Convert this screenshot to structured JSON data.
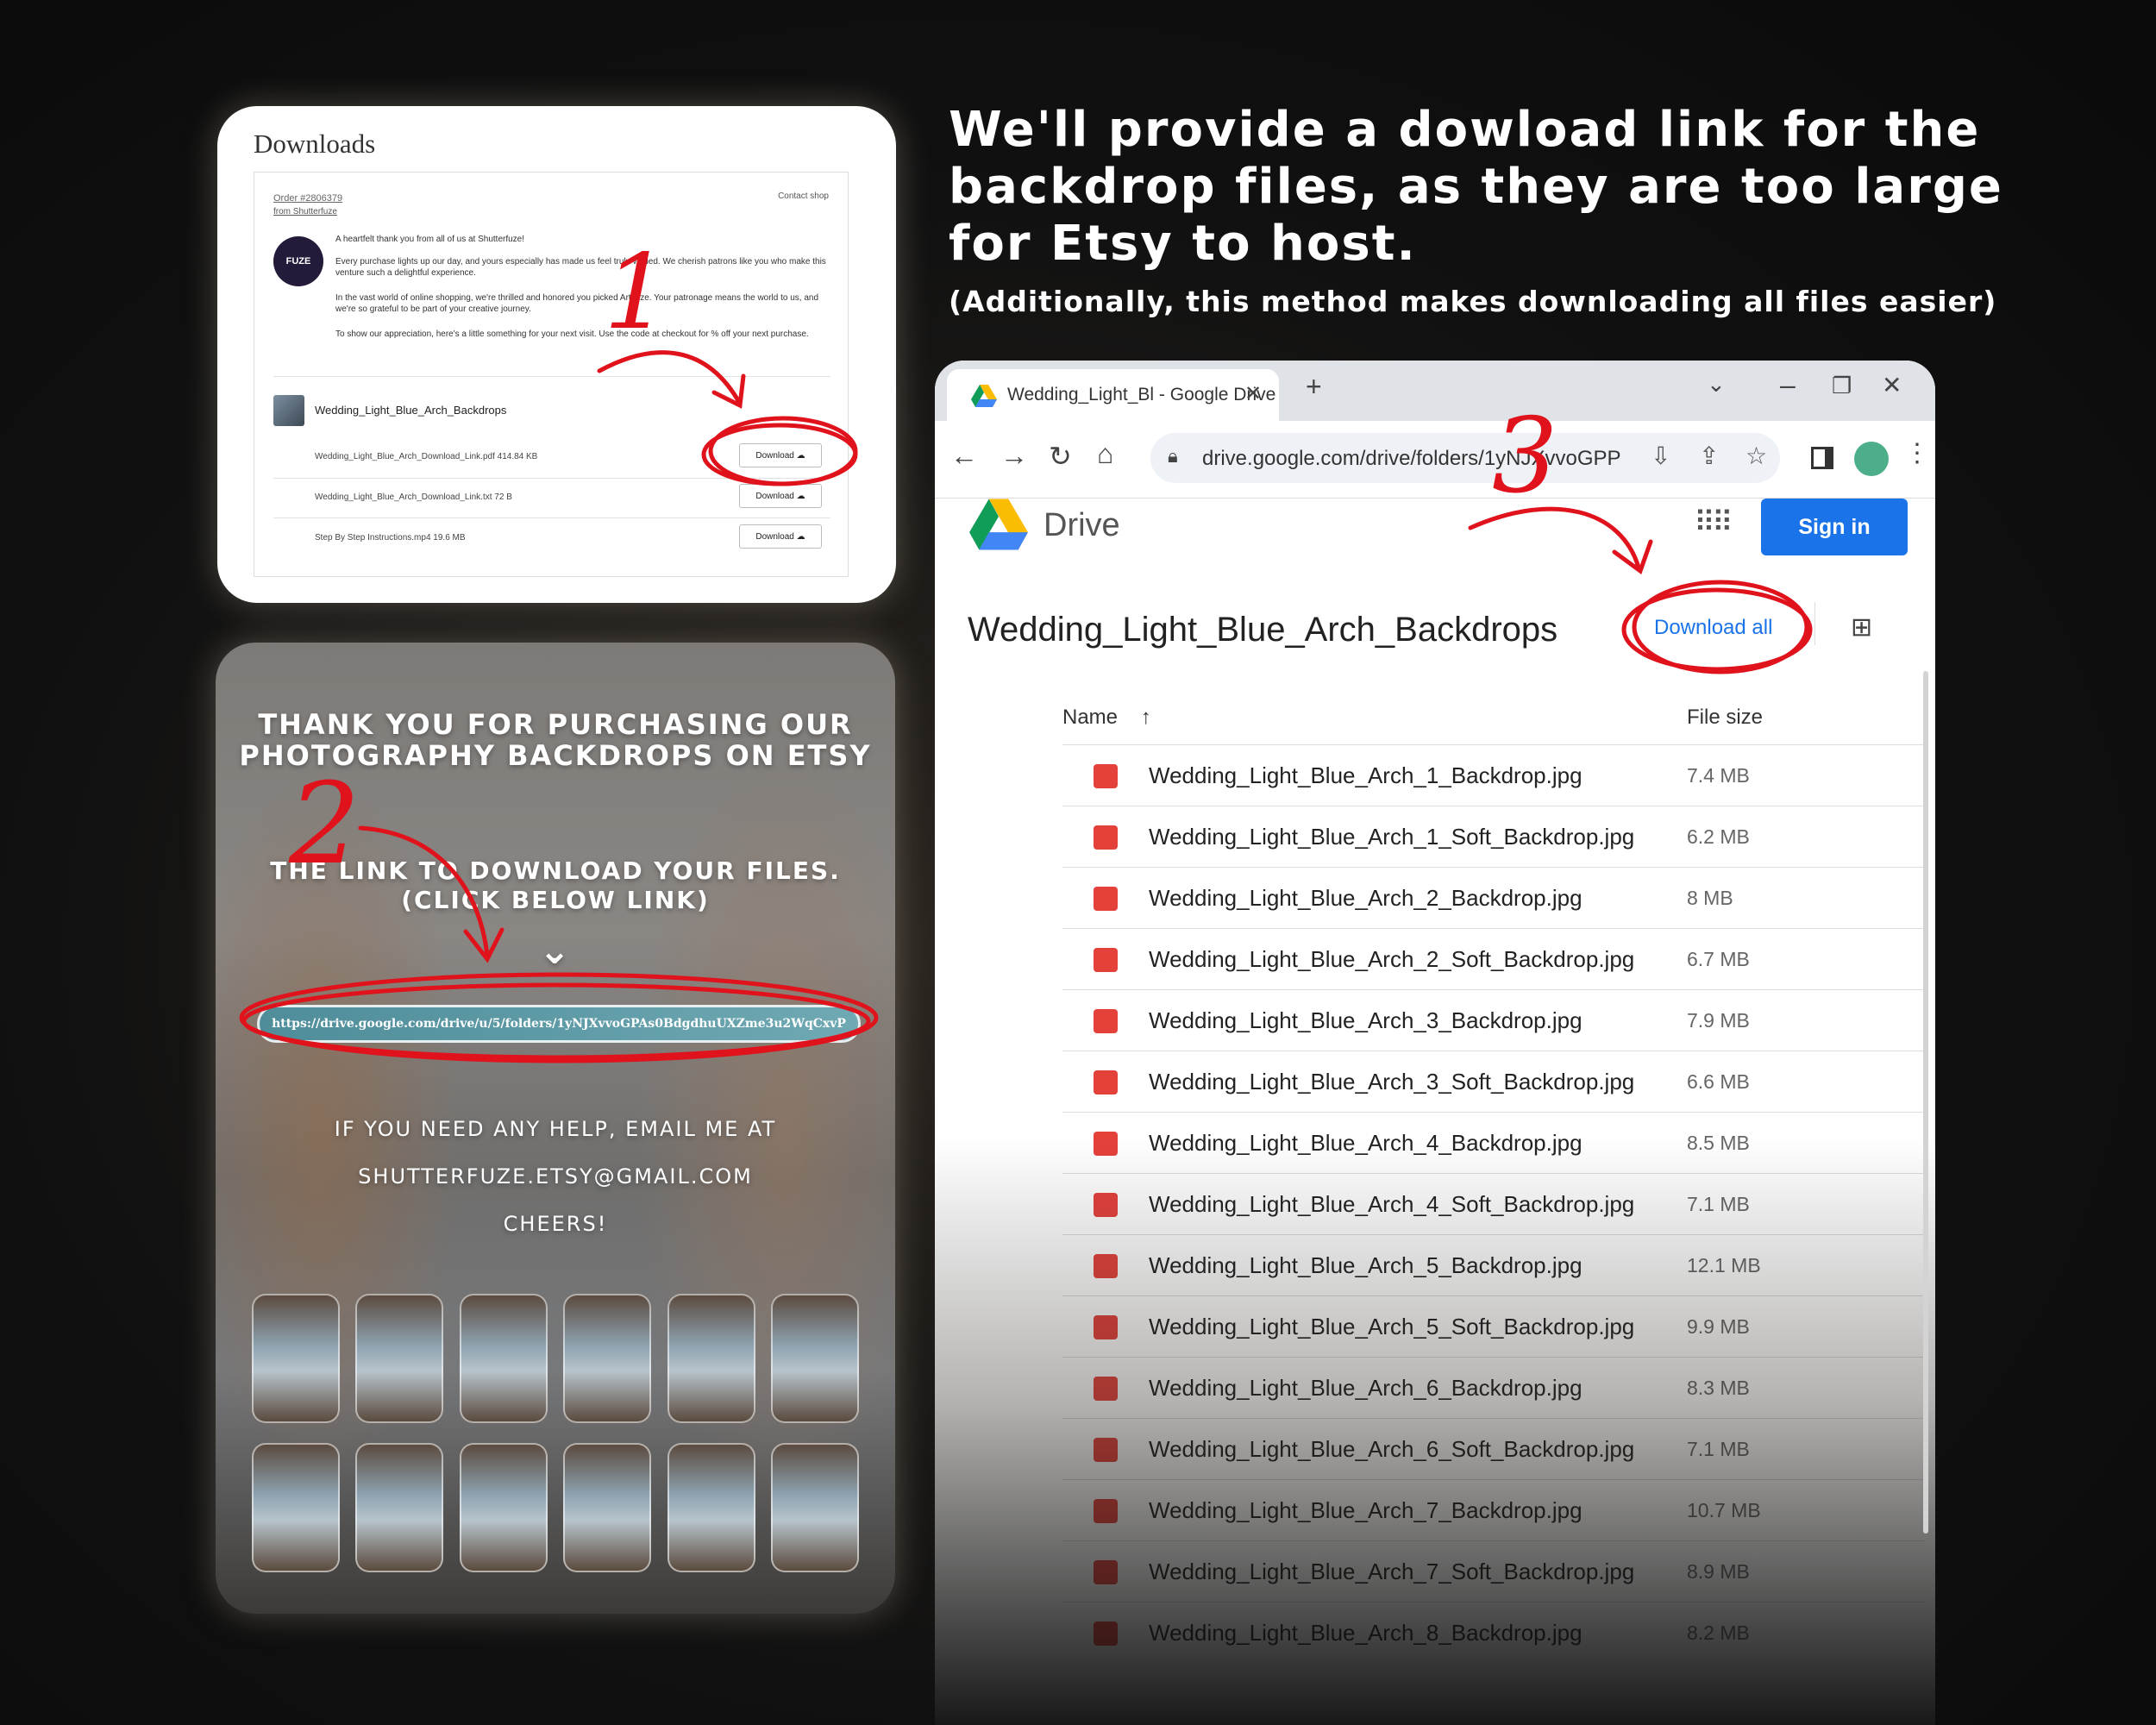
{
  "headline": "We'll provide a dowload link for the backdrop files, as they are too large for Etsy to host.",
  "subline": "(Additionally, this method makes downloading all files easier)",
  "etsy": {
    "title": "Downloads",
    "order": "Order #2806379",
    "from_shop": "from Shutterfuze",
    "contact": "Contact shop",
    "avatar": "FUZE",
    "msg1": "A heartfelt thank you from all of us at Shutterfuze!",
    "msg2": "Every purchase lights up our day, and yours especially has made us feel truly valued. We cherish patrons like you who make this venture such a delightful experience.",
    "msg3": "In the vast world of online shopping, we're thrilled and honored you picked Artifuze. Your patronage means the world to us, and we're so grateful to be part of your creative journey.",
    "msg4": "To show our appreciation, here's a little something for your next visit. Use the code at checkout for % off your next purchase.",
    "product": "Wedding_Light_Blue_Arch_Backdrops",
    "files": [
      {
        "name": "Wedding_Light_Blue_Arch_Download_Link.pdf  414.84 KB",
        "button": "Download"
      },
      {
        "name": "Wedding_Light_Blue_Arch_Download_Link.txt  72 B",
        "button": "Download"
      },
      {
        "name": "Step By Step Instructions.mp4  19.6 MB",
        "button": "Download"
      }
    ]
  },
  "thanks": {
    "line1": "THANK YOU FOR PURCHASING OUR",
    "line2": "PHOTOGRAPHY BACKDROPS ON ETSY",
    "link_title1": "THE LINK TO DOWNLOAD YOUR FILES.",
    "link_title2": "(CLICK BELOW LINK)",
    "url": "https://drive.google.com/drive/u/5/folders/1yNJXvvoGPAs0BdgdhuUXZme3u2WqCxvP",
    "help1": "IF YOU NEED ANY HELP, EMAIL ME AT",
    "help2": "SHUTTERFUZE.ETSY@GMAIL.COM",
    "help3": "CHEERS!"
  },
  "steps": [
    "1",
    "2",
    "3"
  ],
  "browser": {
    "tab_title": "Wedding_Light_Bl - Google Drive",
    "url": "drive.google.com/drive/folders/1yNJXvvoGPP",
    "app_name": "Drive",
    "sign_in": "Sign in",
    "folder": "Wedding_Light_Blue_Arch_Backdrops",
    "download_all": "Download all",
    "col_name": "Name",
    "col_size": "File size",
    "files": [
      {
        "name": "Wedding_Light_Blue_Arch_1_Backdrop.jpg",
        "size": "7.4 MB"
      },
      {
        "name": "Wedding_Light_Blue_Arch_1_Soft_Backdrop.jpg",
        "size": "6.2 MB"
      },
      {
        "name": "Wedding_Light_Blue_Arch_2_Backdrop.jpg",
        "size": "8 MB"
      },
      {
        "name": "Wedding_Light_Blue_Arch_2_Soft_Backdrop.jpg",
        "size": "6.7 MB"
      },
      {
        "name": "Wedding_Light_Blue_Arch_3_Backdrop.jpg",
        "size": "7.9 MB"
      },
      {
        "name": "Wedding_Light_Blue_Arch_3_Soft_Backdrop.jpg",
        "size": "6.6 MB"
      },
      {
        "name": "Wedding_Light_Blue_Arch_4_Backdrop.jpg",
        "size": "8.5 MB"
      },
      {
        "name": "Wedding_Light_Blue_Arch_4_Soft_Backdrop.jpg",
        "size": "7.1 MB"
      },
      {
        "name": "Wedding_Light_Blue_Arch_5_Backdrop.jpg",
        "size": "12.1 MB"
      },
      {
        "name": "Wedding_Light_Blue_Arch_5_Soft_Backdrop.jpg",
        "size": "9.9 MB"
      },
      {
        "name": "Wedding_Light_Blue_Arch_6_Backdrop.jpg",
        "size": "8.3 MB"
      },
      {
        "name": "Wedding_Light_Blue_Arch_6_Soft_Backdrop.jpg",
        "size": "7.1 MB"
      },
      {
        "name": "Wedding_Light_Blue_Arch_7_Backdrop.jpg",
        "size": "10.7 MB"
      },
      {
        "name": "Wedding_Light_Blue_Arch_7_Soft_Backdrop.jpg",
        "size": "8.9 MB"
      },
      {
        "name": "Wedding_Light_Blue_Arch_8_Backdrop.jpg",
        "size": "8.2 MB"
      }
    ]
  },
  "colors": {
    "annotation": "#e0131d",
    "drive_blue": "#1a73e8",
    "file_red": "#e5413b"
  }
}
